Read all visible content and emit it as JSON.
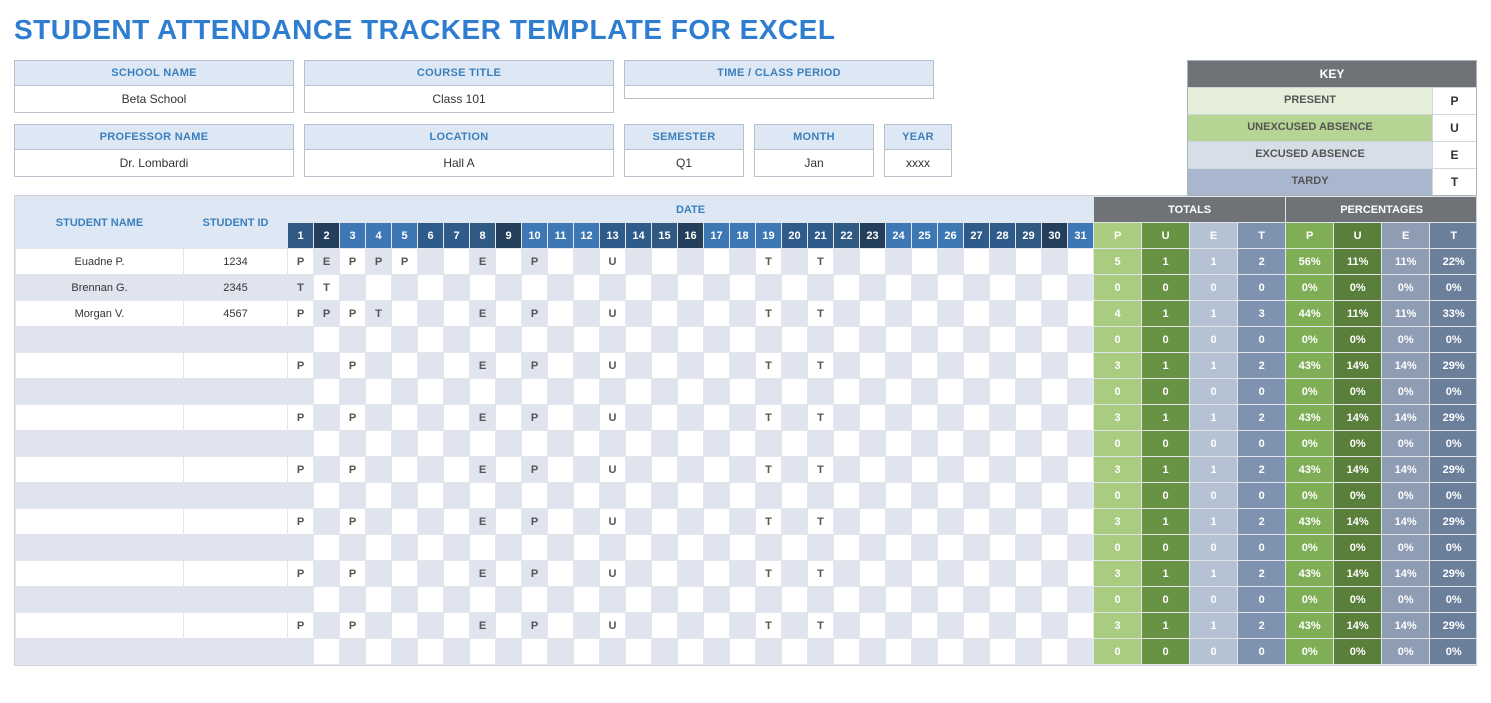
{
  "title": "STUDENT ATTENDANCE TRACKER TEMPLATE FOR EXCEL",
  "info": {
    "school_label": "SCHOOL NAME",
    "school_value": "Beta School",
    "course_label": "COURSE TITLE",
    "course_value": "Class 101",
    "time_label": "TIME / CLASS PERIOD",
    "time_value": "",
    "prof_label": "PROFESSOR NAME",
    "prof_value": "Dr. Lombardi",
    "loc_label": "LOCATION",
    "loc_value": "Hall A",
    "sem_label": "SEMESTER",
    "sem_value": "Q1",
    "month_label": "MONTH",
    "month_value": "Jan",
    "year_label": "YEAR",
    "year_value": "xxxx"
  },
  "key": {
    "header": "KEY",
    "items": [
      {
        "name": "PRESENT",
        "code": "P",
        "cls": "k-p"
      },
      {
        "name": "UNEXCUSED ABSENCE",
        "code": "U",
        "cls": "k-u"
      },
      {
        "name": "EXCUSED ABSENCE",
        "code": "E",
        "cls": "k-e"
      },
      {
        "name": "TARDY",
        "code": "T",
        "cls": "k-t"
      }
    ]
  },
  "grid": {
    "name_header": "STUDENT NAME",
    "id_header": "STUDENT ID",
    "date_header": "DATE",
    "totals_header": "TOTALS",
    "pct_header": "PERCENTAGES",
    "days": [
      "1",
      "2",
      "3",
      "4",
      "5",
      "6",
      "7",
      "8",
      "9",
      "10",
      "11",
      "12",
      "13",
      "14",
      "15",
      "16",
      "17",
      "18",
      "19",
      "20",
      "21",
      "22",
      "23",
      "24",
      "25",
      "26",
      "27",
      "28",
      "29",
      "30",
      "31"
    ],
    "tot_labels": [
      "P",
      "U",
      "E",
      "T"
    ],
    "pct_labels": [
      "P",
      "U",
      "E",
      "T"
    ],
    "rows": [
      {
        "name": "Euadne P.",
        "id": "1234",
        "cells": [
          "P",
          "E",
          "P",
          "P",
          "P",
          "",
          "",
          "E",
          "",
          "P",
          "",
          "",
          "U",
          "",
          "",
          "",
          "",
          "",
          "T",
          "",
          "T",
          "",
          "",
          "",
          "",
          "",
          "",
          "",
          "",
          "",
          ""
        ],
        "tot": [
          "5",
          "1",
          "1",
          "2"
        ],
        "pct": [
          "56%",
          "11%",
          "11%",
          "22%"
        ]
      },
      {
        "name": "Brennan G.",
        "id": "2345",
        "cells": [
          "T",
          "T",
          "",
          "",
          "",
          "",
          "",
          "",
          "",
          "",
          "",
          "",
          "",
          "",
          "",
          "",
          "",
          "",
          "",
          "",
          "",
          "",
          "",
          "",
          "",
          "",
          "",
          "",
          "",
          "",
          ""
        ],
        "tot": [
          "0",
          "0",
          "0",
          "0"
        ],
        "pct": [
          "0%",
          "0%",
          "0%",
          "0%"
        ]
      },
      {
        "name": "Morgan V.",
        "id": "4567",
        "cells": [
          "P",
          "P",
          "P",
          "T",
          "",
          "",
          "",
          "E",
          "",
          "P",
          "",
          "",
          "U",
          "",
          "",
          "",
          "",
          "",
          "T",
          "",
          "T",
          "",
          "",
          "",
          "",
          "",
          "",
          "",
          "",
          "",
          ""
        ],
        "tot": [
          "4",
          "1",
          "1",
          "3"
        ],
        "pct": [
          "44%",
          "11%",
          "11%",
          "33%"
        ]
      },
      {
        "name": "",
        "id": "",
        "cells": [
          "",
          "",
          "",
          "",
          "",
          "",
          "",
          "",
          "",
          "",
          "",
          "",
          "",
          "",
          "",
          "",
          "",
          "",
          "",
          "",
          "",
          "",
          "",
          "",
          "",
          "",
          "",
          "",
          "",
          "",
          ""
        ],
        "tot": [
          "0",
          "0",
          "0",
          "0"
        ],
        "pct": [
          "0%",
          "0%",
          "0%",
          "0%"
        ]
      },
      {
        "name": "",
        "id": "",
        "cells": [
          "P",
          "",
          "P",
          "",
          "",
          "",
          "",
          "E",
          "",
          "P",
          "",
          "",
          "U",
          "",
          "",
          "",
          "",
          "",
          "T",
          "",
          "T",
          "",
          "",
          "",
          "",
          "",
          "",
          "",
          "",
          "",
          ""
        ],
        "tot": [
          "3",
          "1",
          "1",
          "2"
        ],
        "pct": [
          "43%",
          "14%",
          "14%",
          "29%"
        ]
      },
      {
        "name": "",
        "id": "",
        "cells": [
          "",
          "",
          "",
          "",
          "",
          "",
          "",
          "",
          "",
          "",
          "",
          "",
          "",
          "",
          "",
          "",
          "",
          "",
          "",
          "",
          "",
          "",
          "",
          "",
          "",
          "",
          "",
          "",
          "",
          "",
          ""
        ],
        "tot": [
          "0",
          "0",
          "0",
          "0"
        ],
        "pct": [
          "0%",
          "0%",
          "0%",
          "0%"
        ]
      },
      {
        "name": "",
        "id": "",
        "cells": [
          "P",
          "",
          "P",
          "",
          "",
          "",
          "",
          "E",
          "",
          "P",
          "",
          "",
          "U",
          "",
          "",
          "",
          "",
          "",
          "T",
          "",
          "T",
          "",
          "",
          "",
          "",
          "",
          "",
          "",
          "",
          "",
          ""
        ],
        "tot": [
          "3",
          "1",
          "1",
          "2"
        ],
        "pct": [
          "43%",
          "14%",
          "14%",
          "29%"
        ]
      },
      {
        "name": "",
        "id": "",
        "cells": [
          "",
          "",
          "",
          "",
          "",
          "",
          "",
          "",
          "",
          "",
          "",
          "",
          "",
          "",
          "",
          "",
          "",
          "",
          "",
          "",
          "",
          "",
          "",
          "",
          "",
          "",
          "",
          "",
          "",
          "",
          ""
        ],
        "tot": [
          "0",
          "0",
          "0",
          "0"
        ],
        "pct": [
          "0%",
          "0%",
          "0%",
          "0%"
        ]
      },
      {
        "name": "",
        "id": "",
        "cells": [
          "P",
          "",
          "P",
          "",
          "",
          "",
          "",
          "E",
          "",
          "P",
          "",
          "",
          "U",
          "",
          "",
          "",
          "",
          "",
          "T",
          "",
          "T",
          "",
          "",
          "",
          "",
          "",
          "",
          "",
          "",
          "",
          ""
        ],
        "tot": [
          "3",
          "1",
          "1",
          "2"
        ],
        "pct": [
          "43%",
          "14%",
          "14%",
          "29%"
        ]
      },
      {
        "name": "",
        "id": "",
        "cells": [
          "",
          "",
          "",
          "",
          "",
          "",
          "",
          "",
          "",
          "",
          "",
          "",
          "",
          "",
          "",
          "",
          "",
          "",
          "",
          "",
          "",
          "",
          "",
          "",
          "",
          "",
          "",
          "",
          "",
          "",
          ""
        ],
        "tot": [
          "0",
          "0",
          "0",
          "0"
        ],
        "pct": [
          "0%",
          "0%",
          "0%",
          "0%"
        ]
      },
      {
        "name": "",
        "id": "",
        "cells": [
          "P",
          "",
          "P",
          "",
          "",
          "",
          "",
          "E",
          "",
          "P",
          "",
          "",
          "U",
          "",
          "",
          "",
          "",
          "",
          "T",
          "",
          "T",
          "",
          "",
          "",
          "",
          "",
          "",
          "",
          "",
          "",
          ""
        ],
        "tot": [
          "3",
          "1",
          "1",
          "2"
        ],
        "pct": [
          "43%",
          "14%",
          "14%",
          "29%"
        ]
      },
      {
        "name": "",
        "id": "",
        "cells": [
          "",
          "",
          "",
          "",
          "",
          "",
          "",
          "",
          "",
          "",
          "",
          "",
          "",
          "",
          "",
          "",
          "",
          "",
          "",
          "",
          "",
          "",
          "",
          "",
          "",
          "",
          "",
          "",
          "",
          "",
          ""
        ],
        "tot": [
          "0",
          "0",
          "0",
          "0"
        ],
        "pct": [
          "0%",
          "0%",
          "0%",
          "0%"
        ]
      },
      {
        "name": "",
        "id": "",
        "cells": [
          "P",
          "",
          "P",
          "",
          "",
          "",
          "",
          "E",
          "",
          "P",
          "",
          "",
          "U",
          "",
          "",
          "",
          "",
          "",
          "T",
          "",
          "T",
          "",
          "",
          "",
          "",
          "",
          "",
          "",
          "",
          "",
          ""
        ],
        "tot": [
          "3",
          "1",
          "1",
          "2"
        ],
        "pct": [
          "43%",
          "14%",
          "14%",
          "29%"
        ]
      },
      {
        "name": "",
        "id": "",
        "cells": [
          "",
          "",
          "",
          "",
          "",
          "",
          "",
          "",
          "",
          "",
          "",
          "",
          "",
          "",
          "",
          "",
          "",
          "",
          "",
          "",
          "",
          "",
          "",
          "",
          "",
          "",
          "",
          "",
          "",
          "",
          ""
        ],
        "tot": [
          "0",
          "0",
          "0",
          "0"
        ],
        "pct": [
          "0%",
          "0%",
          "0%",
          "0%"
        ]
      },
      {
        "name": "",
        "id": "",
        "cells": [
          "P",
          "",
          "P",
          "",
          "",
          "",
          "",
          "E",
          "",
          "P",
          "",
          "",
          "U",
          "",
          "",
          "",
          "",
          "",
          "T",
          "",
          "T",
          "",
          "",
          "",
          "",
          "",
          "",
          "",
          "",
          "",
          ""
        ],
        "tot": [
          "3",
          "1",
          "1",
          "2"
        ],
        "pct": [
          "43%",
          "14%",
          "14%",
          "29%"
        ]
      },
      {
        "name": "",
        "id": "",
        "cells": [
          "",
          "",
          "",
          "",
          "",
          "",
          "",
          "",
          "",
          "",
          "",
          "",
          "",
          "",
          "",
          "",
          "",
          "",
          "",
          "",
          "",
          "",
          "",
          "",
          "",
          "",
          "",
          "",
          "",
          "",
          ""
        ],
        "tot": [
          "0",
          "0",
          "0",
          "0"
        ],
        "pct": [
          "0%",
          "0%",
          "0%",
          "0%"
        ]
      }
    ]
  }
}
